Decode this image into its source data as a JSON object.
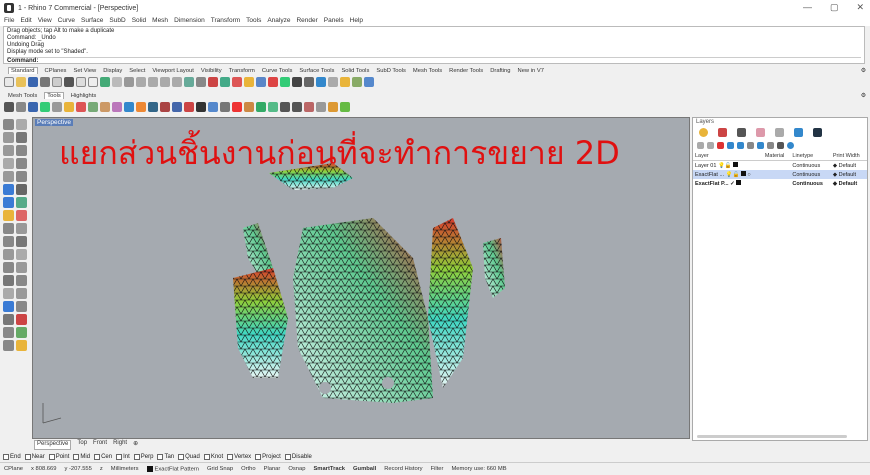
{
  "window": {
    "title": "1 - Rhino 7 Commercial - [Perspective]",
    "controls": [
      "—",
      "▢",
      "✕"
    ]
  },
  "menu": [
    "File",
    "Edit",
    "View",
    "Curve",
    "Surface",
    "SubD",
    "Solid",
    "Mesh",
    "Dimension",
    "Transform",
    "Tools",
    "Analyze",
    "Render",
    "Panels",
    "Help"
  ],
  "command_history": [
    "Drag objects; tap Alt to make a duplicate",
    "Command: _Undo",
    "Undoing Drag",
    "Display mode set to \"Shaded\"."
  ],
  "command_prompt": "Command:",
  "toolbar_tabs_1": [
    "Standard",
    "CPlanes",
    "Set View",
    "Display",
    "Select",
    "Viewport Layout",
    "Visibility",
    "Transform",
    "Curve Tools",
    "Surface Tools",
    "Solid Tools",
    "SubD Tools",
    "Mesh Tools",
    "Render Tools",
    "Drafting",
    "New in V7"
  ],
  "toolbar_tabs_2": [
    "Mesh Tools",
    "Tools",
    "Highlights"
  ],
  "viewport": {
    "label": "Perspective",
    "overlay_text": "แยกส่วนชิ้นงานก่อนที่จะทำการขยาย 2D"
  },
  "view_tabs": [
    "Perspective",
    "Top",
    "Front",
    "Right"
  ],
  "osnaps": [
    "End",
    "Near",
    "Point",
    "Mid",
    "Cen",
    "Int",
    "Perp",
    "Tan",
    "Quad",
    "Knot",
    "Vertex",
    "Project",
    "Disable"
  ],
  "status": {
    "cplane": "CPlane",
    "x": "x 808.669",
    "y": "y -207.555",
    "z": "z",
    "units": "Millimeters",
    "layer": "ExactFlat Pattern",
    "toggles": [
      "Grid Snap",
      "Ortho",
      "Planar",
      "Osnap",
      "SmartTrack",
      "Gumball",
      "Record History",
      "Filter"
    ],
    "memory": "Memory use: 660 MB"
  },
  "layers": {
    "panel_title": "Layers",
    "columns": [
      "Layer",
      "Material",
      "Linetype",
      "Print Width"
    ],
    "rows": [
      {
        "name": "Layer 01",
        "linetype": "Continuous",
        "print": "Default"
      },
      {
        "name": "ExactFlat ...",
        "linetype": "Continuous",
        "print": "Default"
      },
      {
        "name": "ExactFlat P...",
        "check": "✓",
        "linetype": "Continuous",
        "print": "Default"
      }
    ]
  }
}
